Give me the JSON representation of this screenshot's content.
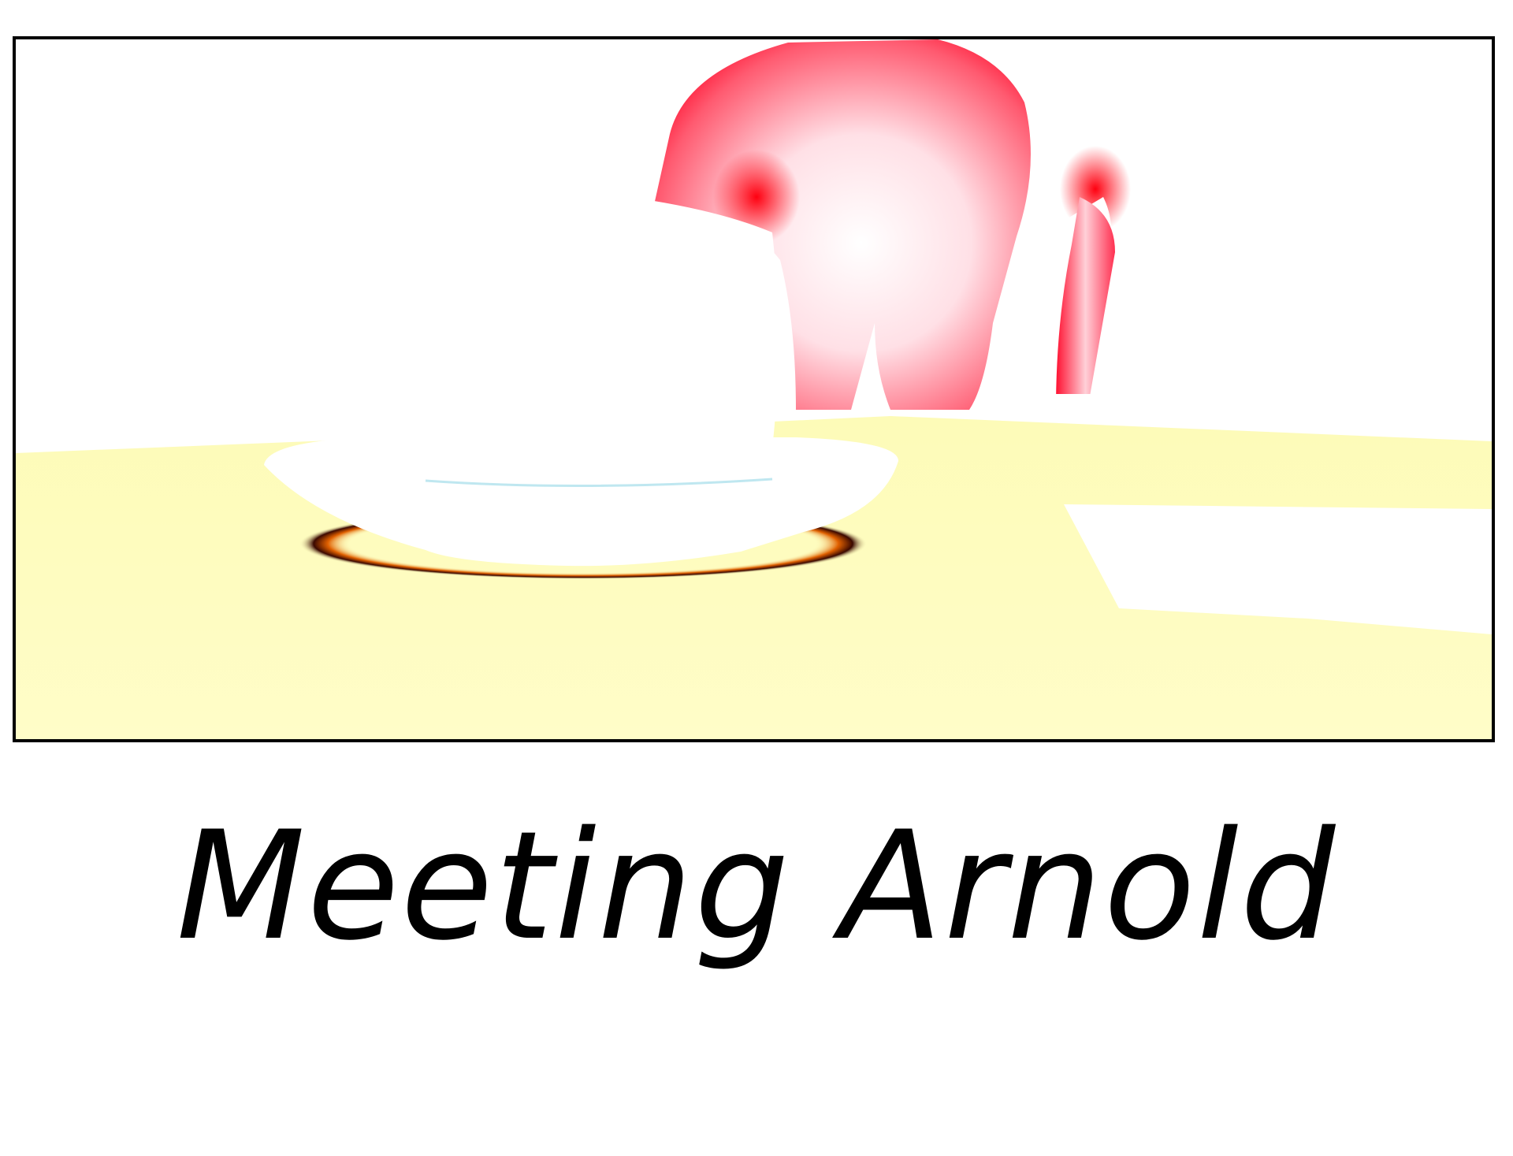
{
  "caption": {
    "text": "Meeting Arnold"
  },
  "scene": {
    "colors": {
      "tabletop": "#fdfbb0",
      "tabletop_light": "#fffdd0",
      "figure_shade": "#ff0020",
      "figure_light": "#ffe8ee",
      "dish": "#ffffff",
      "shadow_ring": "#5a1a00",
      "frame_border": "#000000"
    },
    "objects": [
      "figure-torso",
      "cup",
      "saucer",
      "shadow-ring",
      "paper-sheet",
      "table-surface"
    ]
  }
}
